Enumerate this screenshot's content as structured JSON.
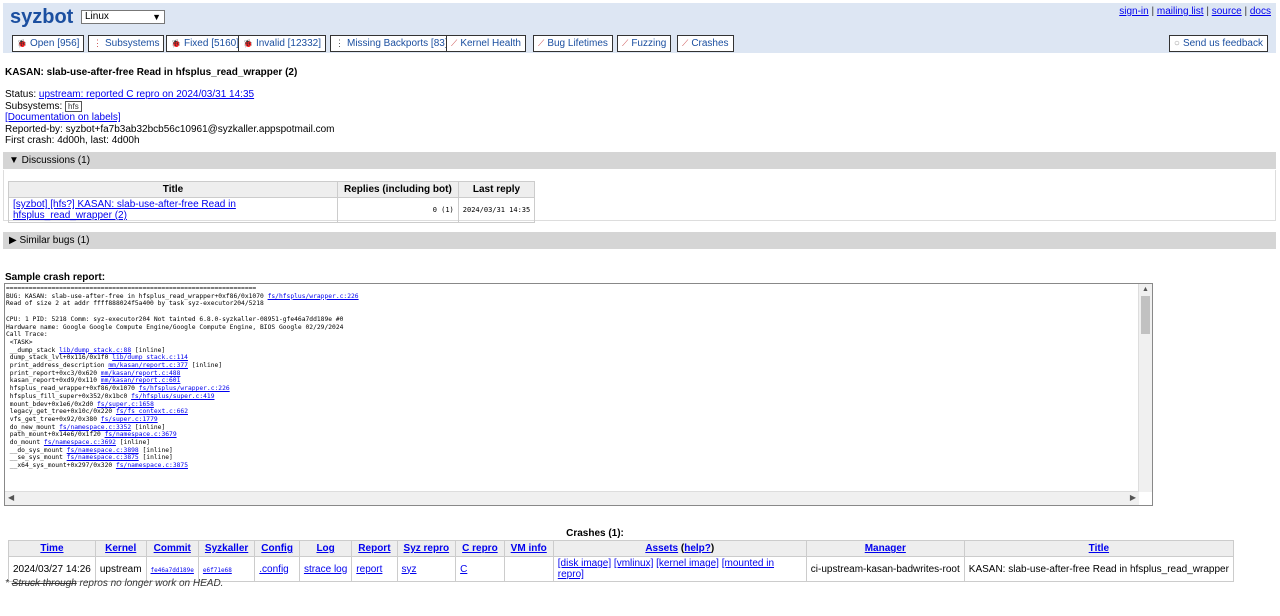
{
  "header": {
    "logo": "syzbot",
    "os_selected": "Linux",
    "toplinks": [
      "sign-in",
      "mailing list",
      "source",
      "docs"
    ],
    "nav": [
      {
        "label": "Open [956]",
        "icon": "bug-icon"
      },
      {
        "label": "Subsystems",
        "icon": "subsystems-icon"
      },
      {
        "label": "Fixed [5160]",
        "icon": "bug-icon"
      },
      {
        "label": "Invalid [12332]",
        "icon": "bug-icon"
      },
      {
        "label": "Missing Backports [83]",
        "icon": "backport-icon"
      },
      {
        "label": "Kernel Health",
        "icon": "graph-icon"
      },
      {
        "label": "Bug Lifetimes",
        "icon": "graph-icon"
      },
      {
        "label": "Fuzzing",
        "icon": "graph-icon"
      },
      {
        "label": "Crashes",
        "icon": "graph-icon"
      }
    ],
    "feedback": "Send us feedback"
  },
  "bug": {
    "title": "KASAN: slab-use-after-free Read in hfsplus_read_wrapper (2)",
    "status_label": "Status:",
    "status_link": "upstream: reported C repro on 2024/03/31 14:35",
    "subsystems_label": "Subsystems:",
    "subsystem": "hfs",
    "doc_link": "[Documentation on labels]",
    "reported_by": "Reported-by: syzbot+fa7b3ab32bcb56c10961@syzkaller.appspotmail.com",
    "first_crash": "First crash: 4d00h, last: 4d00h"
  },
  "discussions": {
    "toggle": "▼ Discussions (1)",
    "headers": [
      "Title",
      "Replies (including bot)",
      "Last reply"
    ],
    "rows": [
      {
        "title": "[syzbot] [hfs?] KASAN: slab-use-after-free Read in hfsplus_read_wrapper (2)",
        "replies": "0 (1)",
        "last": "2024/03/31 14:35"
      }
    ]
  },
  "similar": {
    "toggle": "▶ Similar bugs (1)"
  },
  "sample": {
    "title": "Sample crash report:",
    "lines": [
      "==================================================================",
      "BUG: KASAN: slab-use-after-free in hfsplus_read_wrapper+0xf86/0x1070 |fs/hfsplus/wrapper.c:226",
      "Read of size 2 at addr ffff888024f5a400 by task syz-executor204/5218",
      "",
      "CPU: 1 PID: 5218 Comm: syz-executor204 Not tainted 6.8.0-syzkaller-08951-gfe46a7dd189e #0",
      "Hardware name: Google Google Compute Engine/Google Compute Engine, BIOS Google 02/29/2024",
      "Call Trace:",
      " <TASK>",
      " __dump_stack |lib/dump_stack.c:88| [inline]",
      " dump_stack_lvl+0x116/0x1f0 |lib/dump_stack.c:114",
      " print_address_description |mm/kasan/report.c:377| [inline]",
      " print_report+0xc3/0x620 |mm/kasan/report.c:488",
      " kasan_report+0xd9/0x110 |mm/kasan/report.c:601",
      " hfsplus_read_wrapper+0xf86/0x1070 |fs/hfsplus/wrapper.c:226",
      " hfsplus_fill_super+0x352/0x1bc0 |fs/hfsplus/super.c:419",
      " mount_bdev+0x1e6/0x2d0 |fs/super.c:1658",
      " legacy_get_tree+0x10c/0x220 |fs/fs_context.c:662",
      " vfs_get_tree+0x92/0x380 |fs/super.c:1779",
      " do_new_mount |fs/namespace.c:3352| [inline]",
      " path_mount+0x14e6/0x1f20 |fs/namespace.c:3679",
      " do_mount |fs/namespace.c:3692| [inline]",
      " __do_sys_mount |fs/namespace.c:3898| [inline]",
      " __se_sys_mount |fs/namespace.c:3875| [inline]",
      " __x64_sys_mount+0x297/0x320 |fs/namespace.c:3875"
    ]
  },
  "crashes": {
    "caption": "Crashes (1):",
    "headers": [
      "Time",
      "Kernel",
      "Commit",
      "Syzkaller",
      "Config",
      "Log",
      "Report",
      "Syz repro",
      "C repro",
      "VM info",
      "Assets",
      "Manager",
      "Title"
    ],
    "assets_help": "help?",
    "row": {
      "time": "2024/03/27 14:26",
      "kernel": "upstream",
      "commit": "fe46a7dd189e",
      "syzkaller": "e6f71e68",
      "config": ".config",
      "log": "strace log",
      "report": "report",
      "syz": "syz",
      "c": "C",
      "vm": "",
      "assets": [
        "[disk image]",
        "[vmlinux]",
        "[kernel image]",
        "[mounted in repro]"
      ],
      "manager": "ci-upstream-kasan-badwrites-root",
      "title": "KASAN: slab-use-after-free Read in hfsplus_read_wrapper"
    }
  },
  "footer": {
    "prefix": "* ",
    "struck": "Struck through",
    "rest": " repros no longer work on HEAD."
  }
}
